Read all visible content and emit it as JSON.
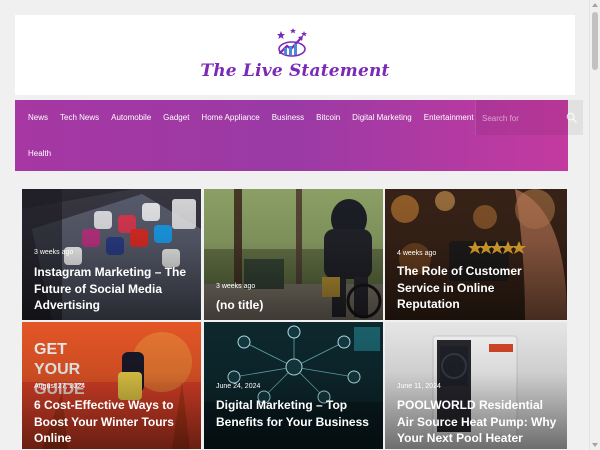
{
  "site": {
    "name": "The Live Statement",
    "accent": "#7b2ab6",
    "logo_icon": "rising-chart-stars-icon"
  },
  "nav": {
    "items": [
      {
        "label": "News"
      },
      {
        "label": "Tech News"
      },
      {
        "label": "Automobile"
      },
      {
        "label": "Gadget"
      },
      {
        "label": "Home Appliance"
      },
      {
        "label": "Business"
      },
      {
        "label": "Bitcoin"
      },
      {
        "label": "Digital Marketing"
      },
      {
        "label": "Entertainment"
      },
      {
        "label": "Health"
      }
    ],
    "search_placeholder": "Search for",
    "gradient": [
      "#a637a3",
      "#c33aa0"
    ]
  },
  "posts": [
    {
      "meta": "3 weeks ago",
      "title": "Instagram Marketing – The Future of Social Media Advertising"
    },
    {
      "meta": "3 weeks ago",
      "title": "(no title)"
    },
    {
      "meta": "4 weeks ago",
      "title": "The Role of Customer Service in Online Reputation"
    },
    {
      "meta": "August 27, 2024",
      "title": "6 Cost-Effective Ways to Boost Your Winter Tours Online"
    },
    {
      "meta": "June 24, 2024",
      "title": "Digital Marketing – Top Benefits for Your Business"
    },
    {
      "meta": "June 11, 2024",
      "title": "POOLWORLD Residential Air Source Heat Pump: Why Your Next Pool Heater"
    }
  ]
}
